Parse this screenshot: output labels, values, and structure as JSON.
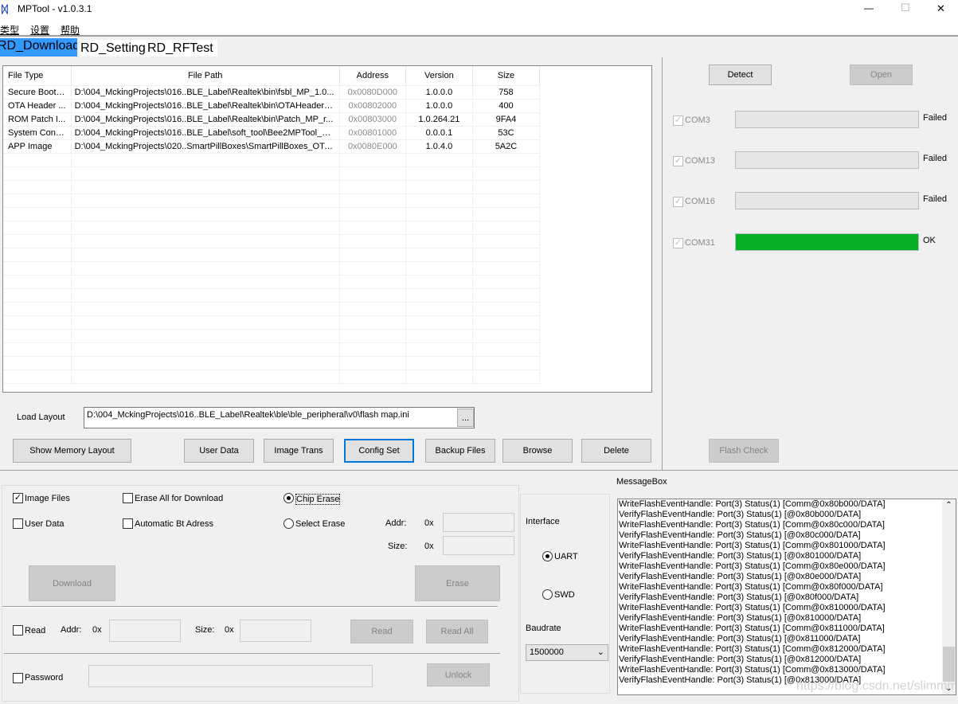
{
  "window": {
    "title": "MPTool - v1.0.3.1",
    "minimize": "—",
    "maximize": "☐",
    "close": "✕"
  },
  "menu": [
    "类型",
    "设置",
    "帮助"
  ],
  "tabs": [
    {
      "label": "RD_Download",
      "active": true
    },
    {
      "label": "RD_Setting",
      "active": false
    },
    {
      "label": "RD_RFTest",
      "active": false
    }
  ],
  "table": {
    "columns": [
      "File Type",
      "File Path",
      "Address",
      "Version",
      "Size"
    ],
    "rows": [
      [
        "Secure Boot ...",
        "D:\\004_MckingProjects\\016..BLE_Label\\Realtek\\bin\\fsbl_MP_1.0...",
        "0x0080D000",
        "1.0.0.0",
        "758"
      ],
      [
        "OTA Header ...",
        "D:\\004_MckingProjects\\016..BLE_Label\\Realtek\\bin\\OTAHeader_...",
        "0x00802000",
        "1.0.0.0",
        "400"
      ],
      [
        "ROM Patch I...",
        "D:\\004_MckingProjects\\016..BLE_Label\\Realtek\\bin\\Patch_MP_r...",
        "0x00803000",
        "1.0.264.21",
        "9FA4"
      ],
      [
        "System Confi...",
        "D:\\004_MckingProjects\\016..BLE_Label\\soft_tool\\Bee2MPTool_ki...",
        "0x00801000",
        "0.0.0.1",
        "53C"
      ],
      [
        "APP Image",
        "D:\\004_MckingProjects\\020..SmartPillBoxes\\SmartPillBoxes_OTA...",
        "0x0080E000",
        "1.0.4.0",
        "5A2C"
      ]
    ]
  },
  "load_layout": {
    "label": "Load Layout",
    "value": "D:\\004_MckingProjects\\016..BLE_Label\\Realtek\\ble\\ble_peripheral\\v0\\flash map.ini",
    "browse": "..."
  },
  "buttons": {
    "show_memory_layout": "Show Memory Layout",
    "user_data": "User Data",
    "image_trans": "Image Trans",
    "config_set": "Config Set",
    "backup_files": "Backup Files",
    "browse": "Browse",
    "delete": "Delete",
    "detect": "Detect",
    "open": "Open",
    "flash_check": "Flash Check",
    "download": "Download",
    "erase": "Erase",
    "read": "Read",
    "read_all": "Read All",
    "unlock": "Unlock"
  },
  "ports": [
    {
      "name": "COM3",
      "checked": true,
      "progress": 0,
      "status": "Failed"
    },
    {
      "name": "COM13",
      "checked": true,
      "progress": 0,
      "status": "Failed"
    },
    {
      "name": "COM16",
      "checked": true,
      "progress": 0,
      "status": "Failed"
    },
    {
      "name": "COM31",
      "checked": true,
      "progress": 100,
      "status": "OK"
    }
  ],
  "colors": {
    "ok_bar": "#06b025",
    "tab_active": "#3399ff",
    "focus": "#0078d7"
  },
  "options": {
    "image_files": {
      "label": "Image Files",
      "checked": true
    },
    "user_data": {
      "label": "User Data",
      "checked": false
    },
    "erase_all": {
      "label": "Erase All for Download",
      "checked": false
    },
    "auto_bt": {
      "label": "Automatic Bt Adress",
      "checked": false
    },
    "chip_erase": {
      "label": "Chip Erase",
      "selected": true
    },
    "select_erase": {
      "label": "Select Erase",
      "selected": false
    },
    "addr_label": "Addr:",
    "size_label": "Size:",
    "hex_prefix": "0x",
    "read": {
      "label": "Read",
      "checked": false
    },
    "password": {
      "label": "Password",
      "checked": false
    }
  },
  "interface": {
    "label": "Interface",
    "uart": "UART",
    "swd": "SWD",
    "selected": "UART",
    "baudrate_label": "Baudrate",
    "baudrate": "1500000"
  },
  "messagebox": {
    "label": "MessageBox",
    "lines": [
      "WriteFlashEventHandle: Port(3) Status(1) [Comm@0x80b000/DATA]",
      "VerifyFlashEventHandle: Port(3) Status(1) [@0x80b000/DATA]",
      "WriteFlashEventHandle: Port(3) Status(1) [Comm@0x80c000/DATA]",
      "VerifyFlashEventHandle: Port(3) Status(1) [@0x80c000/DATA]",
      "WriteFlashEventHandle: Port(3) Status(1) [Comm@0x801000/DATA]",
      "VerifyFlashEventHandle: Port(3) Status(1) [@0x801000/DATA]",
      "WriteFlashEventHandle: Port(3) Status(1) [Comm@0x80e000/DATA]",
      "VerifyFlashEventHandle: Port(3) Status(1) [@0x80e000/DATA]",
      "WriteFlashEventHandle: Port(3) Status(1) [Comm@0x80f000/DATA]",
      "VerifyFlashEventHandle: Port(3) Status(1) [@0x80f000/DATA]",
      "WriteFlashEventHandle: Port(3) Status(1) [Comm@0x810000/DATA]",
      "VerifyFlashEventHandle: Port(3) Status(1) [@0x810000/DATA]",
      "WriteFlashEventHandle: Port(3) Status(1) [Comm@0x811000/DATA]",
      "VerifyFlashEventHandle: Port(3) Status(1) [@0x811000/DATA]",
      "WriteFlashEventHandle: Port(3) Status(1) [Comm@0x812000/DATA]",
      "VerifyFlashEventHandle: Port(3) Status(1) [@0x812000/DATA]",
      "WriteFlashEventHandle: Port(3) Status(1) [Comm@0x813000/DATA]",
      "VerifyFlashEventHandle: Port(3) Status(1) [@0x813000/DATA]"
    ],
    "watermark": "https://blog.csdn.net/slimmm"
  }
}
